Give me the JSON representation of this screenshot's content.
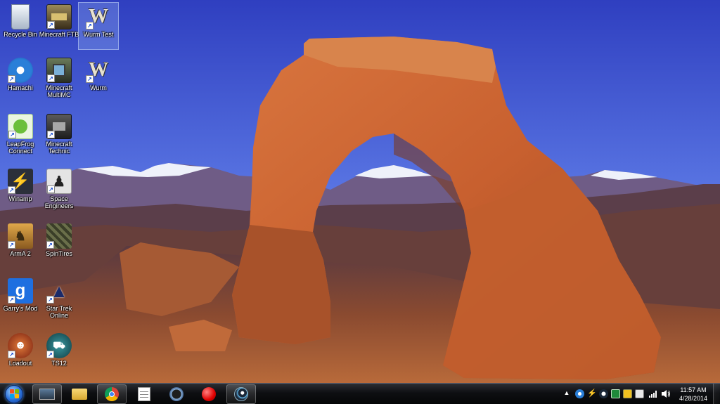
{
  "desktop": {
    "icons": [
      {
        "label": "Recycle Bin",
        "icon": "recycle-bin-icon",
        "color": "#c9d3df"
      },
      {
        "label": "Minecraft FTB",
        "icon": "minecraft-ftb-icon",
        "color": "#5a4a2a"
      },
      {
        "label": "Wurm Test",
        "icon": "wurm-test-icon",
        "color": "#e9e2cf"
      },
      {
        "label": "Hamachi",
        "icon": "hamachi-icon",
        "color": "#2a7fd8"
      },
      {
        "label": "Minecraft MultiMC",
        "icon": "minecraft-multimc-icon",
        "color": "#3f4a3a"
      },
      {
        "label": "Wurm",
        "icon": "wurm-icon",
        "color": "#e9e2cf"
      },
      {
        "label": "LeapFrog Connect",
        "icon": "leapfrog-connect-icon",
        "color": "#eaf6e0"
      },
      {
        "label": "Minecraft Technic",
        "icon": "minecraft-technic-icon",
        "color": "#3a3a3a"
      },
      {
        "label": "Winamp",
        "icon": "winamp-icon",
        "color": "#2b2f3a"
      },
      {
        "label": "Space Engineers",
        "icon": "space-engineers-icon",
        "color": "#d8d8d8"
      },
      {
        "label": "ArmA 2",
        "icon": "arma-2-icon",
        "color": "#c28a3a"
      },
      {
        "label": "SpinTires",
        "icon": "spintires-icon",
        "color": "#5a5f3a"
      },
      {
        "label": "Garry's Mod",
        "icon": "garrys-mod-icon",
        "color": "#1e6fe0"
      },
      {
        "label": "Star Trek Online",
        "icon": "star-trek-online-icon",
        "color": "#1a2a6a"
      },
      {
        "label": "Loadout",
        "icon": "loadout-icon",
        "color": "#a03a20"
      },
      {
        "label": "TS12",
        "icon": "ts12-icon",
        "color": "#1f6a72"
      }
    ]
  },
  "taskbar": {
    "start": {
      "icon": "windows-start-orb-icon"
    },
    "pinned": [
      {
        "icon": "windows-explorer-computer-icon",
        "active": true
      },
      {
        "icon": "file-explorer-folder-icon",
        "active": false
      },
      {
        "icon": "chrome-icon",
        "active": true
      },
      {
        "icon": "notepad-icon",
        "active": false
      },
      {
        "icon": "teamspeak-icon",
        "active": false
      },
      {
        "icon": "record-icon",
        "active": false
      },
      {
        "icon": "steam-icon",
        "active": false
      }
    ],
    "tray": {
      "chevron": "▲",
      "icons": [
        "hamachi-tray-icon",
        "lightning-tray-icon",
        "steam-tray-icon",
        "green-app-tray-icon",
        "norton-tray-icon",
        "power-tray-icon",
        "network-signal-icon",
        "volume-icon"
      ]
    },
    "clock": {
      "time": "11:57 AM",
      "date": "4/28/2014"
    }
  }
}
